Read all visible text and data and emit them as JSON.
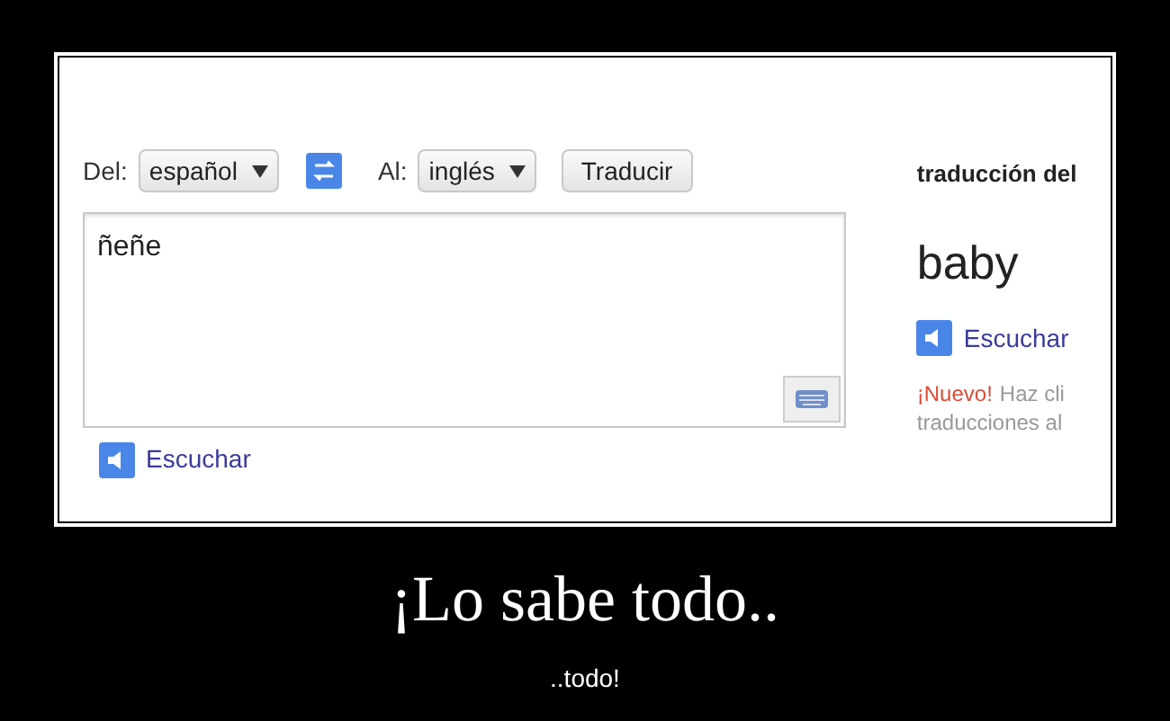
{
  "source": {
    "from_label": "Del:",
    "from_language": "español",
    "to_label": "Al:",
    "to_language": "inglés",
    "translate_button": "Traducir",
    "text": "ñeñe",
    "listen": "Escuchar"
  },
  "result": {
    "heading": "traducción del",
    "text": "baby",
    "listen": "Escuchar",
    "new_badge": "¡Nuevo!",
    "hint_lines": [
      "Haz cli",
      "traducciones al"
    ]
  },
  "caption": {
    "title": "¡Lo sabe todo..",
    "subtitle": "..todo!"
  }
}
